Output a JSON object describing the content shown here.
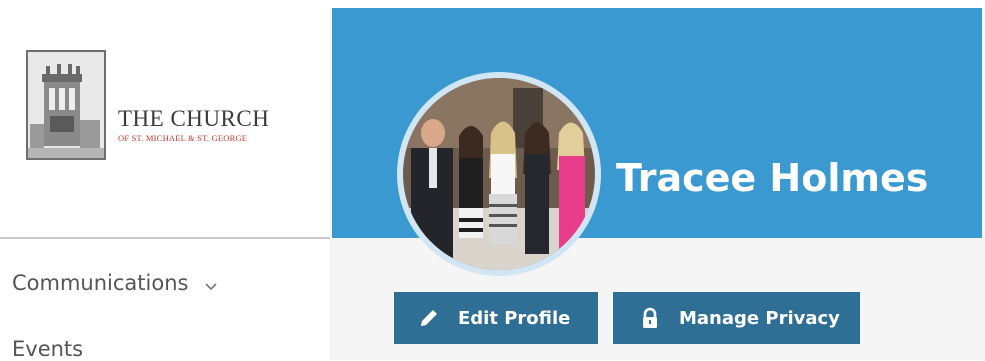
{
  "brand": {
    "name_line1": "THE CHURCH",
    "name_line2": "OF ST. MICHAEL & ST. GEORGE"
  },
  "sidebar": {
    "items": [
      {
        "label": "Communications",
        "icon": "chevron-down-icon"
      },
      {
        "label": "Events"
      }
    ]
  },
  "profile": {
    "name": "Tracee Holmes",
    "photo_icon": "family-photo"
  },
  "actions": {
    "edit_label": "Edit Profile",
    "edit_icon": "pencil-icon",
    "privacy_label": "Manage Privacy",
    "privacy_icon": "lock-icon"
  },
  "colors": {
    "banner": "#3a99d0",
    "button": "#2f6f95",
    "accent_red": "#c0392b"
  }
}
